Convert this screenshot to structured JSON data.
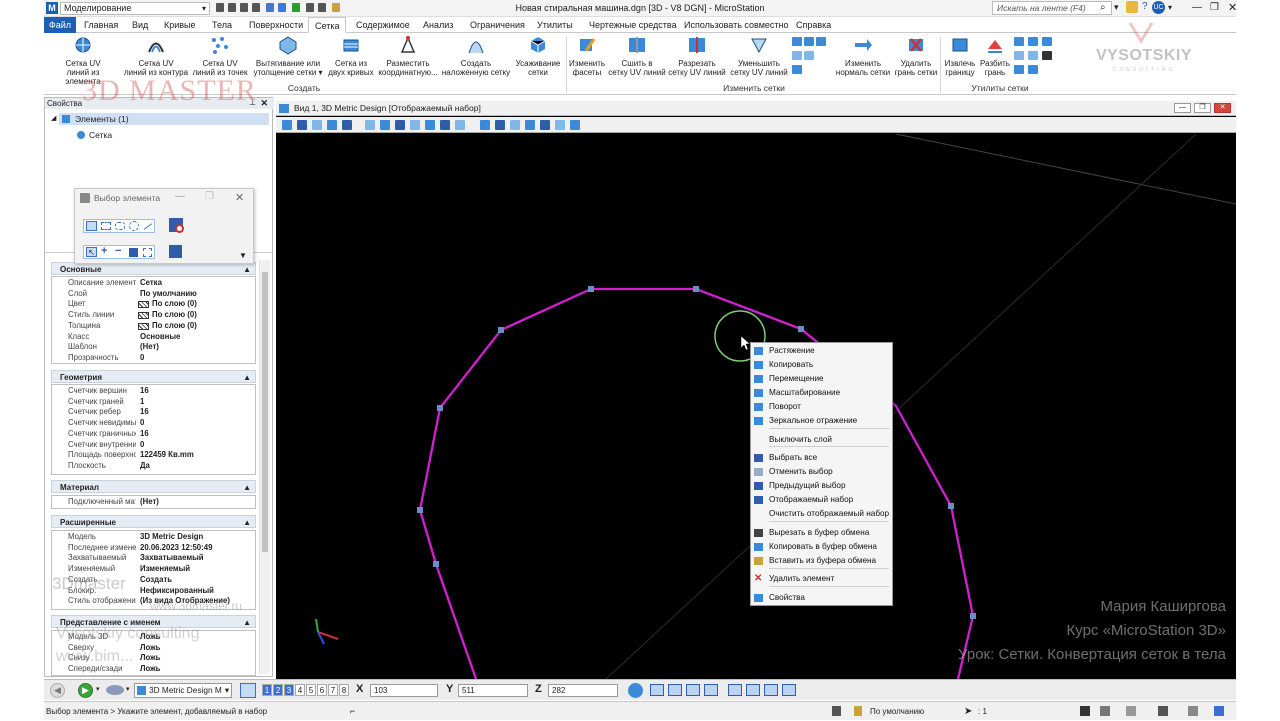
{
  "titlebar": {
    "workspace": "Моделирование",
    "window_title": "Новая стиральная машина.dgn [3D - V8 DGN] - MicroStation",
    "search_placeholder": "Искать на ленте (F4)"
  },
  "menu": {
    "file": "Файл",
    "tabs": [
      "Главная",
      "Вид",
      "Кривые",
      "Тела",
      "Поверхности",
      "Сетка",
      "Содержимое",
      "Анализ",
      "Ограничения",
      "Утилиты",
      "Чертежные средства",
      "Использовать совместно",
      "Справка"
    ],
    "active_tab": "Сетка"
  },
  "ribbon": {
    "create_group_label": "Создать",
    "modify_group_label": "Изменить сетки",
    "utils_group_label": "Утилиты сетки",
    "buttons": [
      {
        "l1": "Сетка UV",
        "l2": "линий из элемента"
      },
      {
        "l1": "Сетка UV",
        "l2": "линий из контура"
      },
      {
        "l1": "Сетка UV",
        "l2": "линий из точек"
      },
      {
        "l1": "Вытягивание или",
        "l2": "утолщение сетки ▾"
      },
      {
        "l1": "Сетка из",
        "l2": "двух кривых"
      },
      {
        "l1": "Разместить",
        "l2": "координатную..."
      },
      {
        "l1": "Создать",
        "l2": "наложенную сетку"
      },
      {
        "l1": "Усаживание",
        "l2": "сетки"
      },
      {
        "l1": "Изменить",
        "l2": "фасеты"
      },
      {
        "l1": "Сшить в",
        "l2": "сетку UV линий"
      },
      {
        "l1": "Разрезать",
        "l2": "сетку UV линий"
      },
      {
        "l1": "Уменьшить",
        "l2": "сетку UV линий"
      },
      {
        "l1": "Изменить",
        "l2": "нормаль сетки"
      },
      {
        "l1": "Удалить",
        "l2": "грань сетки"
      },
      {
        "l1": "Извлечь",
        "l2": "границу"
      },
      {
        "l1": "Разбить",
        "l2": "грань"
      }
    ]
  },
  "watermarks": {
    "brand_top": "3D MASTER",
    "vysotskiy": "VYSOTSKIY",
    "consulting": "CONSULTING",
    "brand_side": "3Dmaster",
    "url1": "www.3dmaster.ru",
    "vc": "Vysotskiy consulting",
    "url2": "www.bim..."
  },
  "properties": {
    "title": "Свойства",
    "tree_root": "Элементы (1)",
    "tree_child": "Сетка",
    "sections": {
      "basic": "Основные",
      "geometry": "Геометрия",
      "material": "Материал",
      "extended": "Расширенные",
      "named": "Представление с именем"
    },
    "basic_rows": [
      {
        "label": "Описание элемента",
        "value": "Сетка"
      },
      {
        "label": "Слой",
        "value": "По умолчанию"
      },
      {
        "label": "Цвет",
        "value": "По слою (0)"
      },
      {
        "label": "Стиль линии",
        "value": "По слою (0)"
      },
      {
        "label": "Толщина",
        "value": "По слою (0)"
      },
      {
        "label": "Класс",
        "value": "Основные"
      },
      {
        "label": "Шаблон",
        "value": "(Нет)"
      },
      {
        "label": "Прозрачность",
        "value": "0"
      }
    ],
    "geometry_rows": [
      {
        "label": "Счетчик вершин",
        "value": "16"
      },
      {
        "label": "Счетчик граней",
        "value": "1"
      },
      {
        "label": "Счетчик ребер",
        "value": "16"
      },
      {
        "label": "Счетчик невидимых",
        "value": "0"
      },
      {
        "label": "Счетчик граничных",
        "value": "16"
      },
      {
        "label": "Счетчик внутренних",
        "value": "0"
      },
      {
        "label": "Площадь поверхности",
        "value": "122459  Кв.mm"
      },
      {
        "label": "Плоскость",
        "value": "Да"
      }
    ],
    "material_rows": [
      {
        "label": "Подключенный материал",
        "value": "(Нет)"
      }
    ],
    "extended_rows": [
      {
        "label": "Модель",
        "value": "3D Metric Design"
      },
      {
        "label": "Последнее изменение",
        "value": "20.06.2023 12:50:49"
      },
      {
        "label": "Захватываемый",
        "value": "Захватываемый"
      },
      {
        "label": "Изменяемый",
        "value": "Изменяемый"
      },
      {
        "label": "Создать",
        "value": "Создать"
      },
      {
        "label": "Блокир.",
        "value": "Нефиксированный"
      },
      {
        "label": "Стиль отображения",
        "value": "(Из вида Отображение)"
      }
    ],
    "named_rows": [
      {
        "label": "Модель 3D",
        "value": "Ложь"
      },
      {
        "label": "Сверху",
        "value": "Ложь"
      },
      {
        "label": "Снизу",
        "value": "Ложь"
      },
      {
        "label": "Спереди/сзади",
        "value": "Ложь"
      }
    ]
  },
  "select_dialog": {
    "title": "Выбор элемента"
  },
  "view": {
    "title": "Вид 1, 3D Metric Design [Отображаемый набор]"
  },
  "context_menu": {
    "items": [
      {
        "label": "Растяжение",
        "icon": "stretch-icon"
      },
      {
        "label": "Копировать",
        "icon": "copy-icon"
      },
      {
        "label": "Перемещение",
        "icon": "move-icon"
      },
      {
        "label": "Масштабирование",
        "icon": "scale-icon"
      },
      {
        "label": "Поворот",
        "icon": "rotate-icon"
      },
      {
        "label": "Зеркальное отражение",
        "icon": "mirror-icon"
      },
      {
        "label": "Выключить слой",
        "icon": ""
      },
      {
        "label": "Выбрать все",
        "icon": "select-all-icon"
      },
      {
        "label": "Отменить выбор",
        "icon": "deselect-icon"
      },
      {
        "label": "Предыдущий выбор",
        "icon": "previous-selection-icon"
      },
      {
        "label": "Отображаемый набор",
        "icon": "display-set-icon"
      },
      {
        "label": "Очистить отображаемый набор",
        "icon": ""
      },
      {
        "label": "Вырезать в буфер обмена",
        "icon": "cut-icon"
      },
      {
        "label": "Копировать в буфер обмена",
        "icon": "clipboard-copy-icon"
      },
      {
        "label": "Вставить из буфера обмена",
        "icon": "paste-icon"
      },
      {
        "label": "Удалить элемент",
        "icon": "delete-icon"
      },
      {
        "label": "Свойства",
        "icon": "properties-icon"
      }
    ]
  },
  "overlay": {
    "line1": "Мария Каширгова",
    "line2": "Курс «MicroStation 3D»",
    "line3": "Урок: Сетки. Конвертация сеток в тела"
  },
  "bottom": {
    "model": "3D Metric Design M",
    "views": [
      "1",
      "2",
      "3",
      "4",
      "5",
      "6",
      "7",
      "8"
    ],
    "x_label": "X",
    "x_value": "103",
    "y_label": "Y",
    "y_value": "511",
    "z_label": "Z",
    "z_value": "282"
  },
  "status": {
    "prompt": "Выбор элемента > Укажите элемент, добавляемый в набор",
    "level": "По умолчанию",
    "count": ": 1"
  },
  "colors": {
    "accent": "#1e5fb4",
    "mesh": "#d21fd2",
    "vertex": "#6a8cc8"
  }
}
